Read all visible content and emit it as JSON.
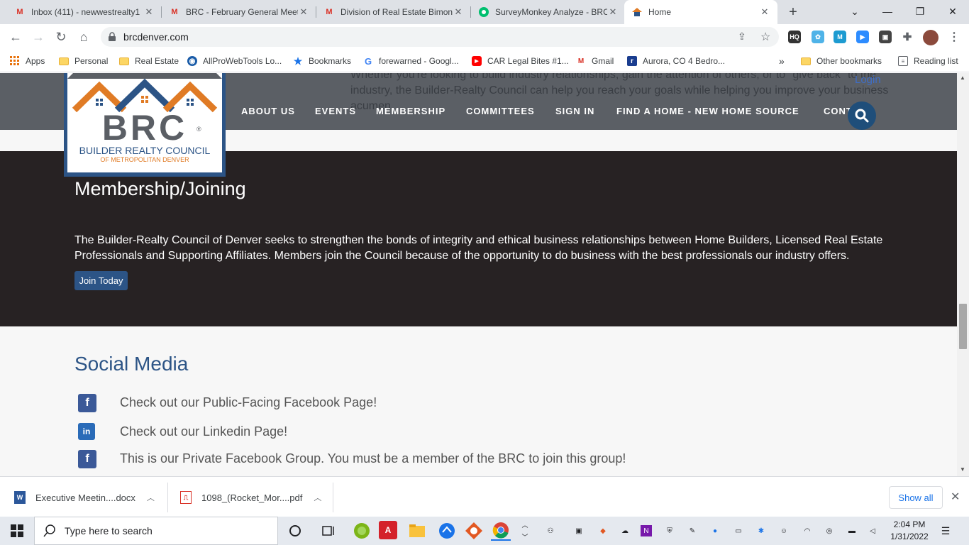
{
  "browser": {
    "tabs": [
      {
        "title": "Inbox (411) - newwestrealty1",
        "icon": "gmail-icon",
        "active": false
      },
      {
        "title": "BRC - February General Meet",
        "icon": "gmail-icon",
        "active": false
      },
      {
        "title": "Division of Real Estate Bimon",
        "icon": "gmail-icon",
        "active": false
      },
      {
        "title": "SurveyMonkey Analyze - BRC",
        "icon": "surveymonkey-icon",
        "active": false
      },
      {
        "title": "Home",
        "icon": "brc-icon",
        "active": true
      }
    ],
    "new_tab": "+",
    "url": "brcdenver.com"
  },
  "bookmarks": {
    "items": [
      "Apps",
      "Personal",
      "Real Estate",
      "AllProWebTools Lo...",
      "Bookmarks",
      "forewarned - Googl...",
      "CAR Legal Bites #1...",
      "Gmail",
      "Aurora, CO 4 Bedro..."
    ],
    "overflow": "»",
    "other": "Other bookmarks",
    "reading_list": "Reading list"
  },
  "site": {
    "hero_overlay_text": "Whether you're looking to build industry relationships, gain the attention of others, or to \"give back\" to the industry, the Builder-Realty Council can help you reach your goals while helping you improve your business acumen.",
    "login": "Login",
    "nav": [
      "ABOUT US",
      "EVENTS",
      "MEMBERSHIP",
      "COMMITTEES",
      "SIGN IN",
      "FIND A HOME - NEW HOME SOURCE",
      "CONT"
    ],
    "logo": {
      "letters": "BRC",
      "registered": "®",
      "line1": "BUILDER REALTY COUNCIL",
      "line2": "OF METROPOLITAN DENVER"
    },
    "membership": {
      "title": "Membership/Joining",
      "body": "The Builder-Realty Council of Denver seeks to strengthen the bonds of integrity and ethical business relationships between Home Builders, Licensed Real Estate Professionals and Supporting Affiliates. Members join the Council because of the opportunity to do business with the best professionals our industry offers.",
      "button": "Join Today"
    },
    "social": {
      "title": "Social Media",
      "items": [
        {
          "icon": "facebook-icon",
          "glyph": "f",
          "text": "Check out our Public-Facing Facebook Page!"
        },
        {
          "icon": "linkedin-icon",
          "glyph": "in",
          "text": "Check out our Linkedin Page!"
        },
        {
          "icon": "facebook-icon",
          "glyph": "f",
          "text": "This is our Private Facebook Group.  You must be a member of the BRC to join this group!"
        }
      ]
    }
  },
  "downloads": {
    "items": [
      {
        "name": "Executive Meetin....docx",
        "type": "word"
      },
      {
        "name": "1098_(Rocket_Mor....pdf",
        "type": "pdf"
      }
    ],
    "show_all": "Show all"
  },
  "taskbar": {
    "search_placeholder": "Type here to search",
    "time": "2:04 PM",
    "date": "1/31/2022"
  },
  "colors": {
    "brand_blue": "#2c5486",
    "nav_gray": "#5b5f65",
    "membership_bg": "#272223",
    "logo_orange": "#e07b25"
  }
}
